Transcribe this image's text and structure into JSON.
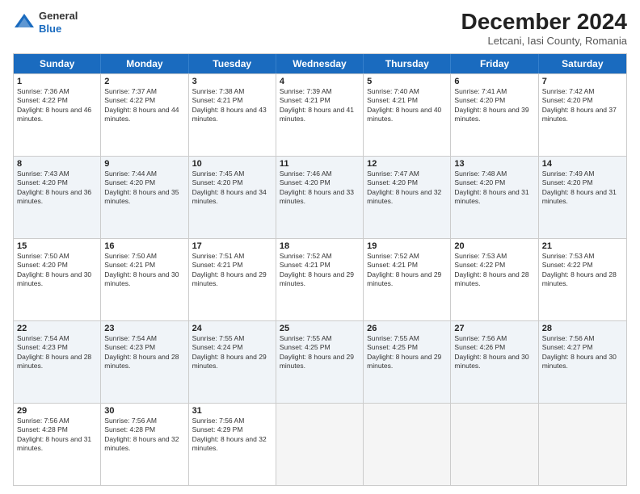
{
  "logo": {
    "line1": "General",
    "line2": "Blue"
  },
  "title": "December 2024",
  "subtitle": "Letcani, Iasi County, Romania",
  "days": [
    "Sunday",
    "Monday",
    "Tuesday",
    "Wednesday",
    "Thursday",
    "Friday",
    "Saturday"
  ],
  "weeks": [
    [
      {
        "day": "1",
        "sun": "Sunrise: 7:36 AM",
        "set": "Sunset: 4:22 PM",
        "day_text": "Daylight: 8 hours and 46 minutes."
      },
      {
        "day": "2",
        "sun": "Sunrise: 7:37 AM",
        "set": "Sunset: 4:22 PM",
        "day_text": "Daylight: 8 hours and 44 minutes."
      },
      {
        "day": "3",
        "sun": "Sunrise: 7:38 AM",
        "set": "Sunset: 4:21 PM",
        "day_text": "Daylight: 8 hours and 43 minutes."
      },
      {
        "day": "4",
        "sun": "Sunrise: 7:39 AM",
        "set": "Sunset: 4:21 PM",
        "day_text": "Daylight: 8 hours and 41 minutes."
      },
      {
        "day": "5",
        "sun": "Sunrise: 7:40 AM",
        "set": "Sunset: 4:21 PM",
        "day_text": "Daylight: 8 hours and 40 minutes."
      },
      {
        "day": "6",
        "sun": "Sunrise: 7:41 AM",
        "set": "Sunset: 4:20 PM",
        "day_text": "Daylight: 8 hours and 39 minutes."
      },
      {
        "day": "7",
        "sun": "Sunrise: 7:42 AM",
        "set": "Sunset: 4:20 PM",
        "day_text": "Daylight: 8 hours and 37 minutes."
      }
    ],
    [
      {
        "day": "8",
        "sun": "Sunrise: 7:43 AM",
        "set": "Sunset: 4:20 PM",
        "day_text": "Daylight: 8 hours and 36 minutes."
      },
      {
        "day": "9",
        "sun": "Sunrise: 7:44 AM",
        "set": "Sunset: 4:20 PM",
        "day_text": "Daylight: 8 hours and 35 minutes."
      },
      {
        "day": "10",
        "sun": "Sunrise: 7:45 AM",
        "set": "Sunset: 4:20 PM",
        "day_text": "Daylight: 8 hours and 34 minutes."
      },
      {
        "day": "11",
        "sun": "Sunrise: 7:46 AM",
        "set": "Sunset: 4:20 PM",
        "day_text": "Daylight: 8 hours and 33 minutes."
      },
      {
        "day": "12",
        "sun": "Sunrise: 7:47 AM",
        "set": "Sunset: 4:20 PM",
        "day_text": "Daylight: 8 hours and 32 minutes."
      },
      {
        "day": "13",
        "sun": "Sunrise: 7:48 AM",
        "set": "Sunset: 4:20 PM",
        "day_text": "Daylight: 8 hours and 31 minutes."
      },
      {
        "day": "14",
        "sun": "Sunrise: 7:49 AM",
        "set": "Sunset: 4:20 PM",
        "day_text": "Daylight: 8 hours and 31 minutes."
      }
    ],
    [
      {
        "day": "15",
        "sun": "Sunrise: 7:50 AM",
        "set": "Sunset: 4:20 PM",
        "day_text": "Daylight: 8 hours and 30 minutes."
      },
      {
        "day": "16",
        "sun": "Sunrise: 7:50 AM",
        "set": "Sunset: 4:21 PM",
        "day_text": "Daylight: 8 hours and 30 minutes."
      },
      {
        "day": "17",
        "sun": "Sunrise: 7:51 AM",
        "set": "Sunset: 4:21 PM",
        "day_text": "Daylight: 8 hours and 29 minutes."
      },
      {
        "day": "18",
        "sun": "Sunrise: 7:52 AM",
        "set": "Sunset: 4:21 PM",
        "day_text": "Daylight: 8 hours and 29 minutes."
      },
      {
        "day": "19",
        "sun": "Sunrise: 7:52 AM",
        "set": "Sunset: 4:21 PM",
        "day_text": "Daylight: 8 hours and 29 minutes."
      },
      {
        "day": "20",
        "sun": "Sunrise: 7:53 AM",
        "set": "Sunset: 4:22 PM",
        "day_text": "Daylight: 8 hours and 28 minutes."
      },
      {
        "day": "21",
        "sun": "Sunrise: 7:53 AM",
        "set": "Sunset: 4:22 PM",
        "day_text": "Daylight: 8 hours and 28 minutes."
      }
    ],
    [
      {
        "day": "22",
        "sun": "Sunrise: 7:54 AM",
        "set": "Sunset: 4:23 PM",
        "day_text": "Daylight: 8 hours and 28 minutes."
      },
      {
        "day": "23",
        "sun": "Sunrise: 7:54 AM",
        "set": "Sunset: 4:23 PM",
        "day_text": "Daylight: 8 hours and 28 minutes."
      },
      {
        "day": "24",
        "sun": "Sunrise: 7:55 AM",
        "set": "Sunset: 4:24 PM",
        "day_text": "Daylight: 8 hours and 29 minutes."
      },
      {
        "day": "25",
        "sun": "Sunrise: 7:55 AM",
        "set": "Sunset: 4:25 PM",
        "day_text": "Daylight: 8 hours and 29 minutes."
      },
      {
        "day": "26",
        "sun": "Sunrise: 7:55 AM",
        "set": "Sunset: 4:25 PM",
        "day_text": "Daylight: 8 hours and 29 minutes."
      },
      {
        "day": "27",
        "sun": "Sunrise: 7:56 AM",
        "set": "Sunset: 4:26 PM",
        "day_text": "Daylight: 8 hours and 30 minutes."
      },
      {
        "day": "28",
        "sun": "Sunrise: 7:56 AM",
        "set": "Sunset: 4:27 PM",
        "day_text": "Daylight: 8 hours and 30 minutes."
      }
    ],
    [
      {
        "day": "29",
        "sun": "Sunrise: 7:56 AM",
        "set": "Sunset: 4:28 PM",
        "day_text": "Daylight: 8 hours and 31 minutes."
      },
      {
        "day": "30",
        "sun": "Sunrise: 7:56 AM",
        "set": "Sunset: 4:28 PM",
        "day_text": "Daylight: 8 hours and 32 minutes."
      },
      {
        "day": "31",
        "sun": "Sunrise: 7:56 AM",
        "set": "Sunset: 4:29 PM",
        "day_text": "Daylight: 8 hours and 32 minutes."
      },
      null,
      null,
      null,
      null
    ]
  ]
}
